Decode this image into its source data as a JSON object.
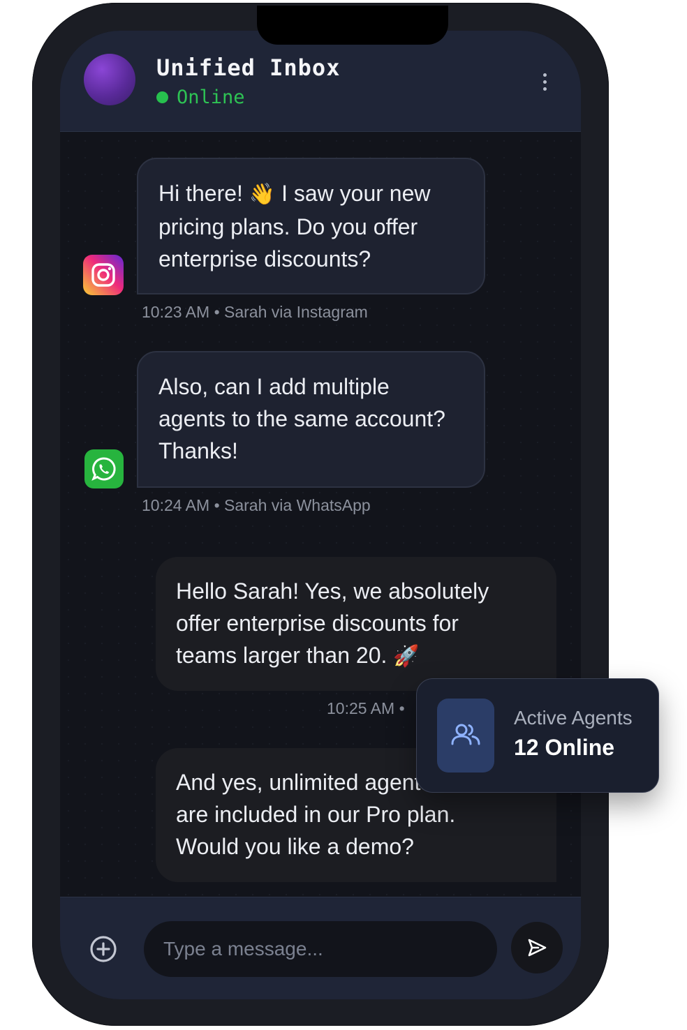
{
  "header": {
    "title": "Unified Inbox",
    "status": "Online"
  },
  "messages": [
    {
      "direction": "incoming",
      "channel": "instagram",
      "text_lines": [
        "Hi there! 👋 I saw your new",
        "pricing plans. Do you offer",
        "enterprise discounts?"
      ],
      "meta": "10:23 AM • Sarah via Instagram"
    },
    {
      "direction": "incoming",
      "channel": "whatsapp",
      "text_lines": [
        "Also, can I add multiple",
        "agents to the same account?",
        "Thanks!"
      ],
      "meta": "10:24 AM • Sarah via WhatsApp"
    },
    {
      "direction": "outgoing",
      "text_lines": [
        "Hello Sarah! Yes, we absolutely",
        "offer enterprise discounts for",
        "teams larger than 20. 🚀"
      ],
      "meta": "10:25 AM •"
    },
    {
      "direction": "outgoing",
      "text_lines": [
        "And yes, unlimited agents",
        "are included in our Pro plan.",
        "Would you like a demo?"
      ],
      "meta": ""
    }
  ],
  "composer": {
    "placeholder": "Type a message..."
  },
  "agents_card": {
    "label": "Active Agents",
    "value": "12 Online"
  },
  "icons": {
    "instagram": "instagram-icon",
    "whatsapp": "whatsapp-icon",
    "attach": "plus-circle-icon",
    "send": "send-icon",
    "menu": "more-vertical-icon",
    "agents": "users-icon"
  },
  "colors": {
    "status_online": "#27c04e",
    "header_bg": "#1f2537",
    "chat_bg": "#12141b",
    "agents_icon_bg": "#2b3d67"
  }
}
